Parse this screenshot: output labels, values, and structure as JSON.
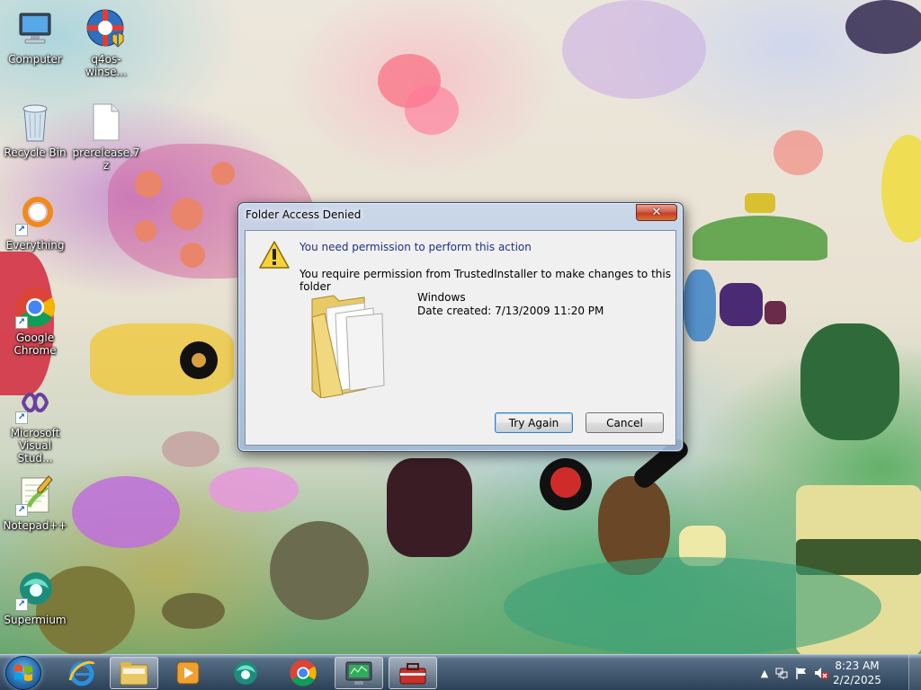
{
  "desktop": {
    "icons": [
      {
        "label": "Computer",
        "icon": "computer-icon"
      },
      {
        "label": "q4os-winse...",
        "icon": "installer-icon"
      },
      {
        "label": "Recycle Bin",
        "icon": "recycle-bin-icon"
      },
      {
        "label": "prerelease.7z",
        "icon": "file-icon"
      },
      {
        "label": "Everything",
        "icon": "everything-search-icon"
      },
      {
        "label": "Google Chrome",
        "icon": "chrome-icon"
      },
      {
        "label": "Microsoft Visual Stud...",
        "icon": "visual-studio-icon"
      },
      {
        "label": "Notepad++",
        "icon": "notepad-plus-plus-icon"
      },
      {
        "label": "Supermium",
        "icon": "supermium-icon"
      }
    ]
  },
  "dialog": {
    "title": "Folder Access Denied",
    "close_label": "✕",
    "main_message": "You need permission to perform this action",
    "sub_message": "You require permission from TrustedInstaller to make changes to this folder",
    "folder_name": "Windows",
    "folder_date": "Date created: 7/13/2009 11:20 PM",
    "try_again_label": "Try Again",
    "cancel_label": "Cancel"
  },
  "taskbar": {
    "pinned": [
      "start-orb",
      "internet-explorer-icon",
      "file-explorer-icon",
      "media-player-icon",
      "supermium-icon",
      "chrome-icon",
      "system-tool-icon",
      "toolbox-icon"
    ],
    "clock_time": "8:23 AM",
    "clock_date": "2/2/2025"
  },
  "colors": {
    "dialog_main_text": "#1e3287",
    "taskbar": "#263c54"
  }
}
